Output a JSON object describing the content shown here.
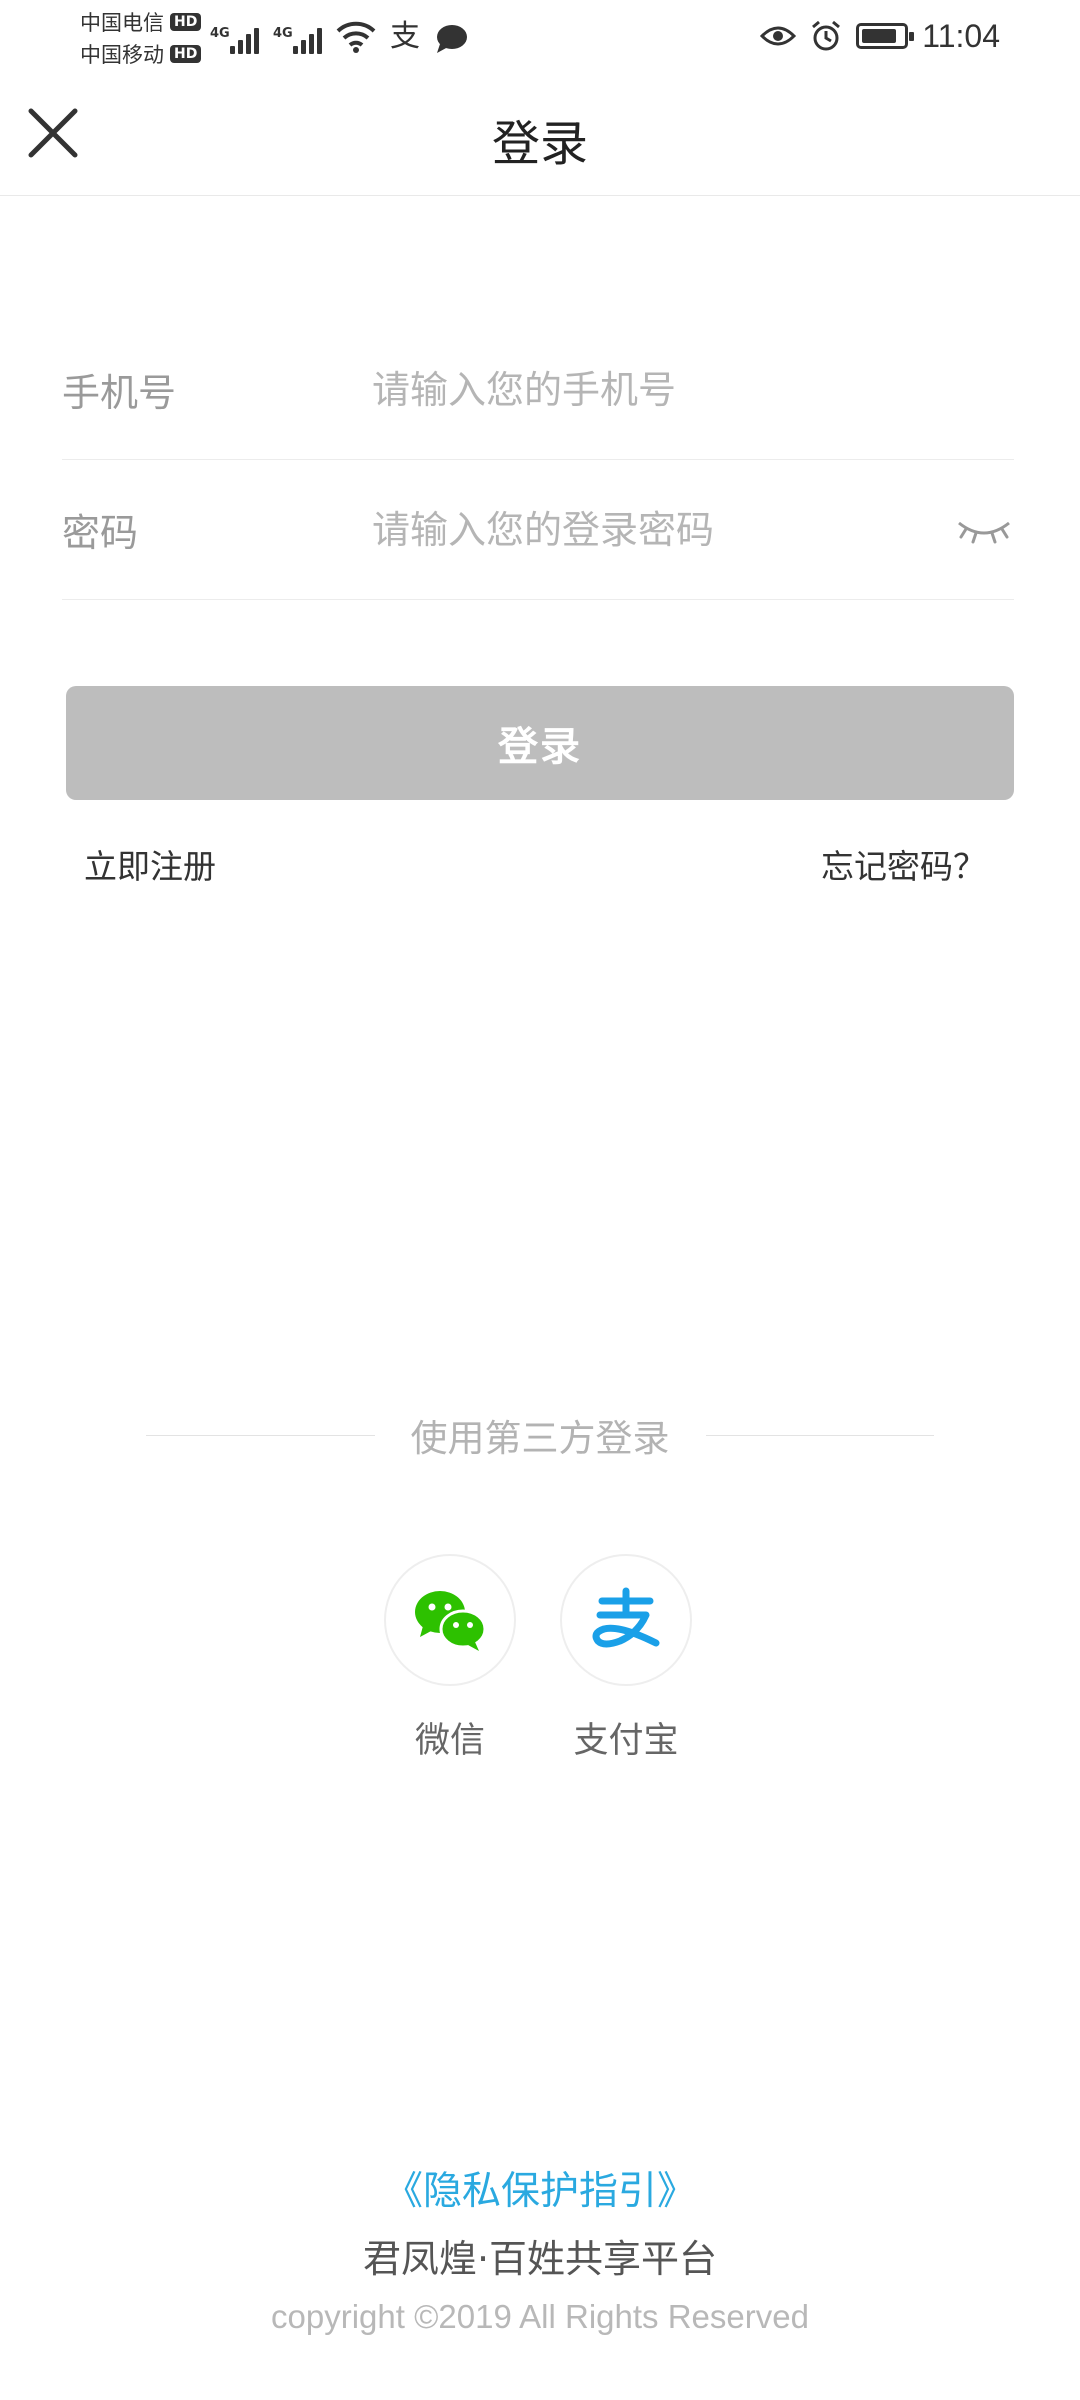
{
  "statusbar": {
    "carrier1": "中国电信",
    "carrier2": "中国移动",
    "hd": "HD",
    "network1": "4G",
    "network2": "4G",
    "alipay_glyph": "支",
    "time": "11:04",
    "battery_level": 0.85
  },
  "header": {
    "title": "登录",
    "close_icon": "close-icon"
  },
  "form": {
    "phone_label": "手机号",
    "phone_placeholder": "请输入您的手机号",
    "password_label": "密码",
    "password_placeholder": "请输入您的登录密码",
    "login_button": "登录",
    "register_link": "立即注册",
    "forgot_link": "忘记密码？"
  },
  "third_party": {
    "title": "使用第三方登录",
    "wechat_label": "微信",
    "alipay_label": "支付宝",
    "wechat_color": "#2dc100",
    "alipay_color": "#1aa0e8"
  },
  "footer": {
    "privacy_link": "《隐私保护指引》",
    "platform_name": "君凤煌·百姓共享平台",
    "copyright": "copyright ©2019 All Rights Reserved"
  }
}
